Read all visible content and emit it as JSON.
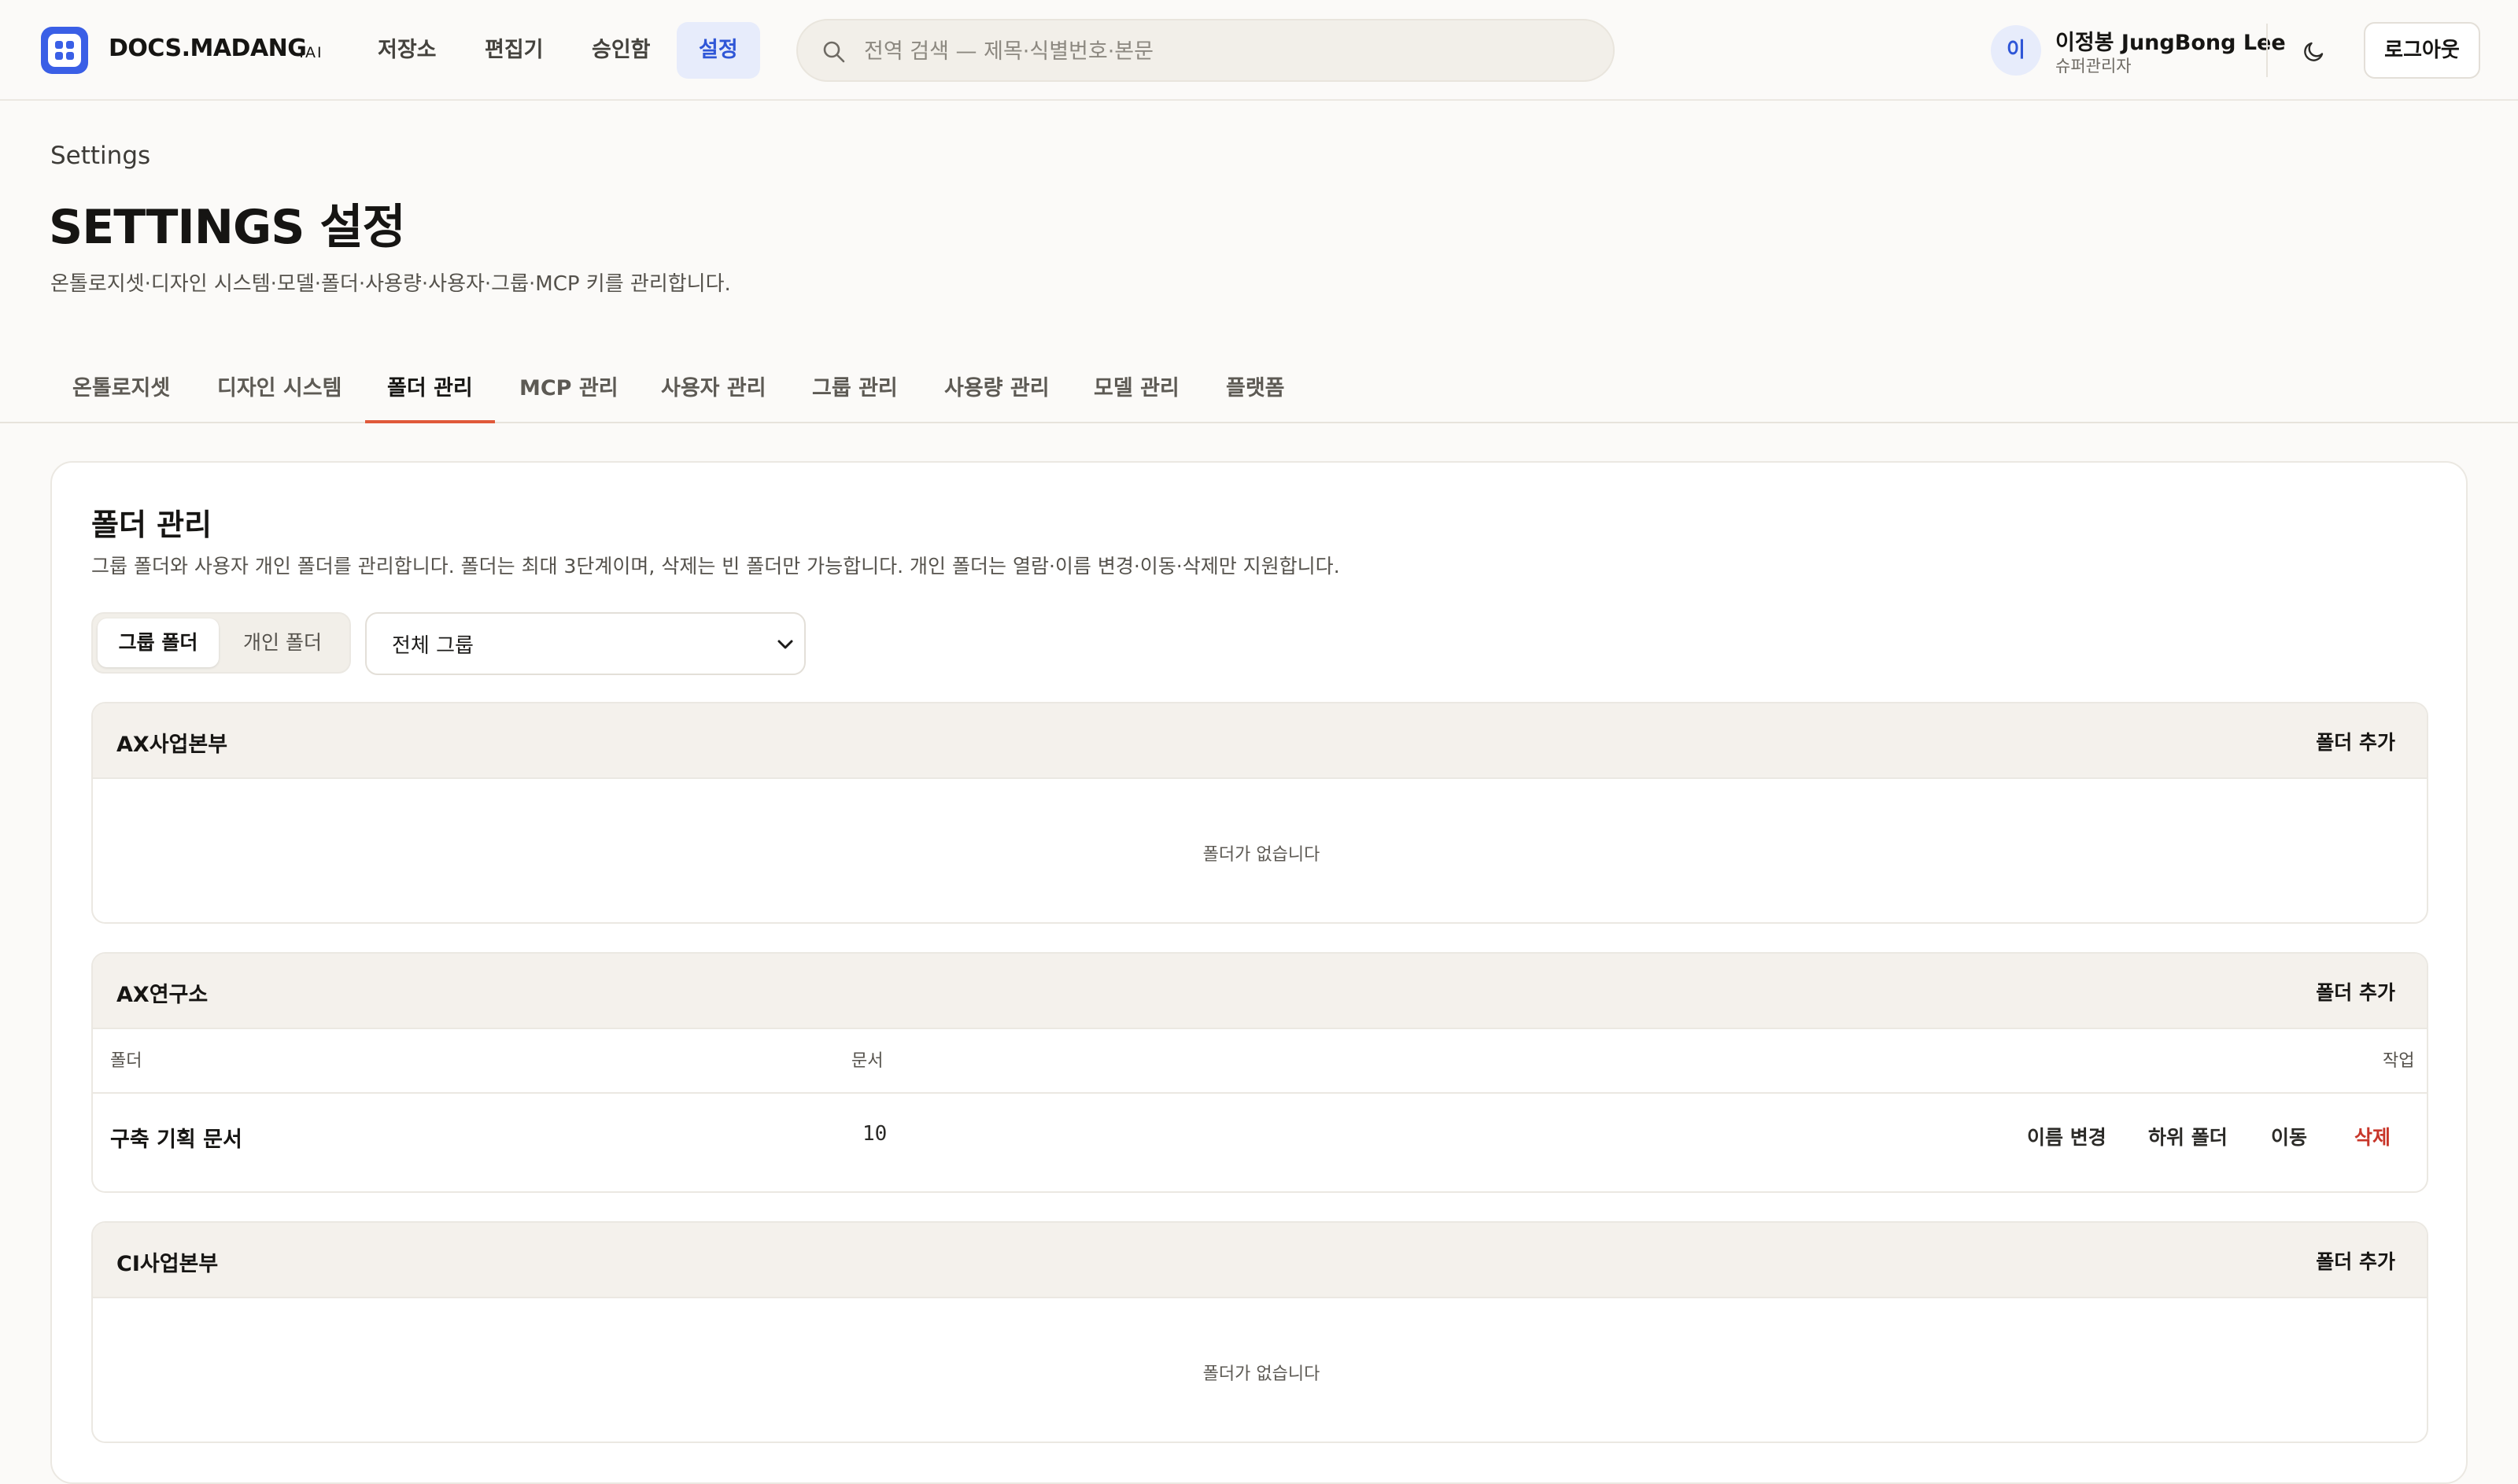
{
  "header": {
    "brand": "DOCS.MADANG",
    "brand_suffix": ".AI",
    "nav": [
      {
        "label": "저장소"
      },
      {
        "label": "편집기"
      },
      {
        "label": "승인함"
      },
      {
        "label": "설정",
        "active": true
      }
    ],
    "search": {
      "placeholder": "전역 검색 — 제목·식별번호·본문",
      "icon": "search-icon"
    },
    "user": {
      "avatar_initial": "이",
      "name": "이정봉 JungBong Lee",
      "role": "슈퍼관리자"
    },
    "theme_icon": "moon-icon",
    "logout_label": "로그아웃"
  },
  "page": {
    "eyebrow": "Settings",
    "title": "SETTINGS 설정",
    "description": "온톨로지셋·디자인 시스템·모델·폴더·사용량·사용자·그룹·MCP 키를 관리합니다."
  },
  "tabs": [
    {
      "label": "온톨로지셋"
    },
    {
      "label": "디자인 시스템"
    },
    {
      "label": "폴더 관리",
      "active": true
    },
    {
      "label": "MCP 관리"
    },
    {
      "label": "사용자 관리"
    },
    {
      "label": "그룹 관리"
    },
    {
      "label": "사용량 관리"
    },
    {
      "label": "모델 관리"
    },
    {
      "label": "플랫폼"
    }
  ],
  "folder_panel": {
    "title": "폴더 관리",
    "description": "그룹 폴더와 사용자 개인 폴더를 관리합니다. 폴더는 최대 3단계이며, 삭제는 빈 폴더만 가능합니다. 개인 폴더는 열람·이름 변경·이동·삭제만 지원합니다.",
    "segments": [
      {
        "label": "그룹 폴더",
        "active": true
      },
      {
        "label": "개인 폴더"
      }
    ],
    "group_select": {
      "value": "전체 그룹"
    },
    "add_folder_label": "폴더 추가",
    "empty_text": "폴더가 없습니다",
    "columns": {
      "folder": "폴더",
      "docs": "문서",
      "actions": "작업"
    },
    "action_labels": {
      "rename": "이름 변경",
      "subfolder": "하위 폴더",
      "move": "이동",
      "delete": "삭제"
    },
    "groups": [
      {
        "name": "AX사업본부",
        "folders": []
      },
      {
        "name": "AX연구소",
        "folders": [
          {
            "name": "구축 기획 문서",
            "doc_count": 10
          }
        ]
      },
      {
        "name": "CI사업본부",
        "folders": []
      }
    ]
  },
  "colors": {
    "accent": "#3a5fe6",
    "active_tab_underline": "#e0593a",
    "danger": "#c8362a",
    "background": "#fbfaf8"
  }
}
